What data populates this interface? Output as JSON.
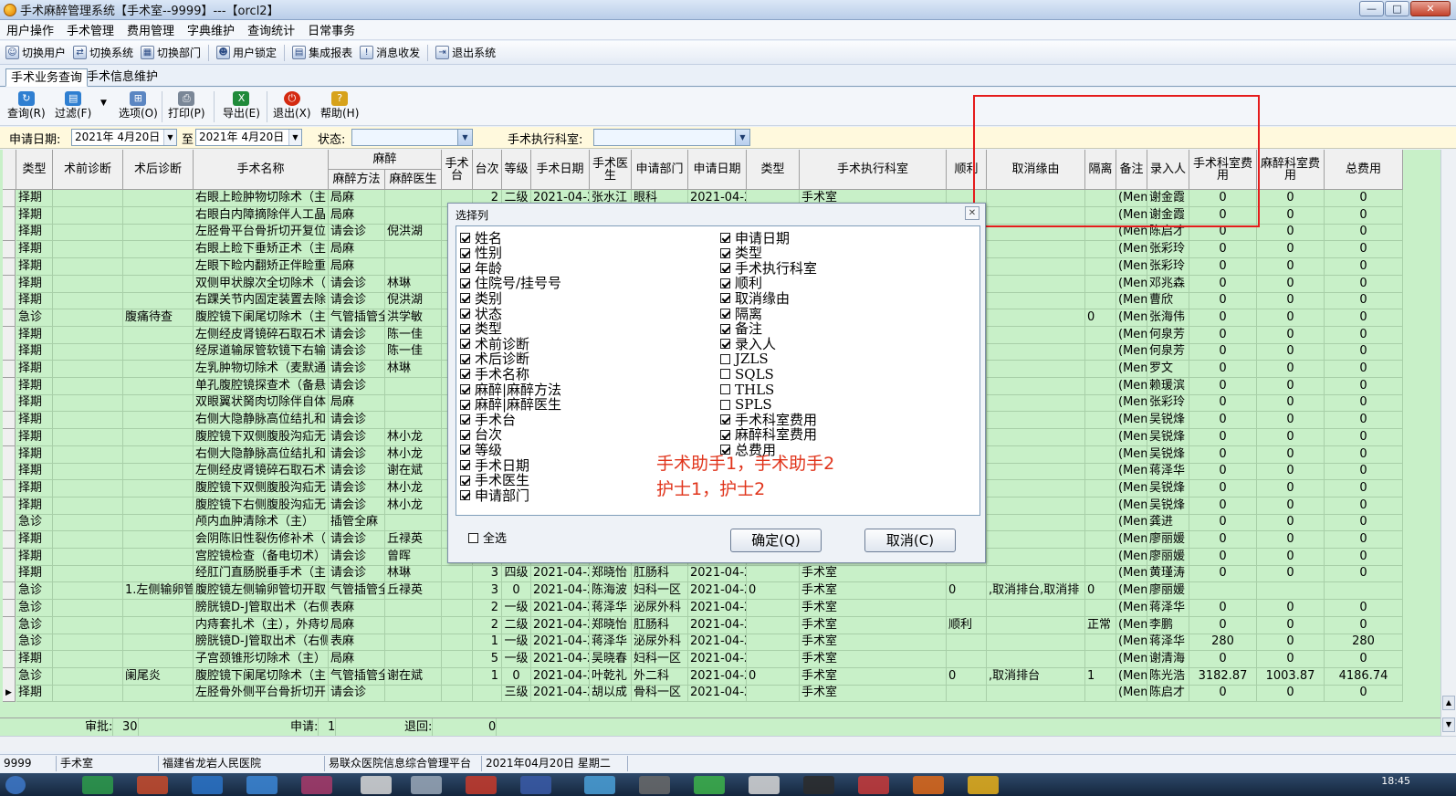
{
  "window": {
    "title": "手术麻醉管理系统【手术室--9999】---【orcl2】",
    "minimize": "—",
    "restore": "□",
    "close": "✕"
  },
  "menu": [
    "用户操作",
    "手术管理",
    "费用管理",
    "字典维护",
    "查询统计",
    "日常事务"
  ],
  "toolbar": [
    {
      "label": "切换用户",
      "icon": "users-icon"
    },
    {
      "label": "切换系统",
      "icon": "switch-system-icon"
    },
    {
      "label": "切换部门",
      "icon": "switch-department-icon"
    },
    {
      "label": "用户锁定",
      "icon": "lock-icon"
    },
    {
      "label": "集成报表",
      "icon": "report-icon"
    },
    {
      "label": "消息收发",
      "icon": "message-icon"
    },
    {
      "label": "退出系统",
      "icon": "exit-icon"
    }
  ],
  "tabs": [
    "手术业务查询",
    "手术信息维护"
  ],
  "actions": [
    {
      "label": "查询(R)",
      "icon": "query-icon",
      "color": "#2f7fd1"
    },
    {
      "label": "过滤(F)",
      "icon": "filter-icon",
      "color": "#2f7fd1"
    },
    {
      "label": "选项(O)",
      "icon": "options-icon",
      "color": "#5b86c2"
    },
    {
      "label": "打印(P)",
      "icon": "print-icon",
      "color": "#7a8797"
    },
    {
      "label": "导出(E)",
      "icon": "excel-icon",
      "color": "#1f8a3a"
    },
    {
      "label": "退出(X)",
      "icon": "power-icon",
      "color": "#d42a10"
    },
    {
      "label": "帮助(H)",
      "icon": "help-icon",
      "color": "#d7a21a"
    }
  ],
  "filter": {
    "date_label": "申请日期:",
    "date_from": "2021年 4月20日",
    "to_label": "至",
    "date_to": "2021年 4月20日",
    "status_label": "状态:",
    "status_value": "",
    "dept_label": "手术执行科室:",
    "dept_value": ""
  },
  "grid": {
    "group_header": "麻醉",
    "headers": [
      "类型",
      "术前诊断",
      "术后诊断",
      "手术名称",
      "麻醉方法",
      "麻醉医生",
      "手术台",
      "台次",
      "等级",
      "手术日期",
      "手术医生",
      "申请部门",
      "申请日期",
      "类型",
      "手术执行科室",
      "顺利",
      "取消缘由",
      "隔离",
      "备注",
      "录入人",
      "手术科室费用",
      "麻醉科室费用",
      "总费用"
    ],
    "rows": [
      [
        "择期",
        "",
        "",
        "右眼上睑肿物切除术（主",
        "局麻",
        "",
        "",
        "2",
        "二级",
        "2021-04-2",
        "张水江",
        "眼科",
        "2021-04-2",
        "",
        "手术室",
        "",
        "",
        "",
        "(Memo",
        "谢金霞",
        "0",
        "0",
        "0"
      ],
      [
        "择期",
        "",
        "",
        "右眼白内障摘除伴人工晶",
        "局麻",
        "",
        "",
        "",
        "",
        "",
        "",
        "",
        "",
        "",
        "",
        "",
        "",
        "",
        "(Memo",
        "谢金霞",
        "0",
        "0",
        "0"
      ],
      [
        "择期",
        "",
        "",
        "左胫骨平台骨折切开复位",
        "请会诊",
        "倪洪湖",
        "",
        "",
        "",
        "",
        "",
        "",
        "",
        "",
        "",
        "",
        "",
        "",
        "(Memo",
        "陈启才",
        "0",
        "0",
        "0"
      ],
      [
        "择期",
        "",
        "",
        "右眼上睑下垂矫正术（主",
        "局麻",
        "",
        "",
        "",
        "",
        "",
        "",
        "",
        "",
        "",
        "",
        "",
        "",
        "",
        "(Memo",
        "张彩玲",
        "0",
        "0",
        "0"
      ],
      [
        "择期",
        "",
        "",
        "左眼下睑内翻矫正伴睑重",
        "局麻",
        "",
        "",
        "",
        "",
        "",
        "",
        "",
        "",
        "",
        "",
        "",
        "",
        "",
        "(Memo",
        "张彩玲",
        "0",
        "0",
        "0"
      ],
      [
        "择期",
        "",
        "",
        "双侧甲状腺次全切除术（",
        "请会诊",
        "林琳",
        "",
        "",
        "",
        "",
        "",
        "",
        "",
        "",
        "",
        "",
        "",
        "",
        "(Memo",
        "邓兆森",
        "0",
        "0",
        "0"
      ],
      [
        "择期",
        "",
        "",
        "右踝关节内固定装置去除",
        "请会诊",
        "倪洪湖",
        "",
        "",
        "",
        "",
        "",
        "",
        "",
        "",
        "",
        "",
        "",
        "",
        "(Memo",
        "曹欣",
        "0",
        "0",
        "0"
      ],
      [
        "急诊",
        "",
        "腹痛待查",
        "腹腔镜下阑尾切除术（主",
        "气管插管全",
        "洪学敏",
        "",
        "",
        "",
        "",
        "",
        "",
        "",
        "",
        "",
        "",
        "",
        "0",
        "(Memo",
        "张海伟",
        "0",
        "0",
        "0"
      ],
      [
        "择期",
        "",
        "",
        "左侧经皮肾镜碎石取石术",
        "请会诊",
        "陈一佳",
        "",
        "",
        "",
        "",
        "",
        "",
        "",
        "",
        "",
        "",
        "",
        "",
        "(Memo",
        "何泉芳",
        "0",
        "0",
        "0"
      ],
      [
        "择期",
        "",
        "",
        "经尿道输尿管软镜下右输",
        "请会诊",
        "陈一佳",
        "",
        "",
        "",
        "",
        "",
        "",
        "",
        "",
        "",
        "",
        "",
        "",
        "(Memo",
        "何泉芳",
        "0",
        "0",
        "0"
      ],
      [
        "择期",
        "",
        "",
        "左乳肿物切除术（麦默通",
        "请会诊",
        "林琳",
        "",
        "",
        "",
        "",
        "",
        "",
        "",
        "",
        "",
        "",
        "",
        "",
        "(Memo",
        "罗文",
        "0",
        "0",
        "0"
      ],
      [
        "择期",
        "",
        "",
        "单孔腹腔镜探查术（备悬",
        "请会诊",
        "",
        "",
        "",
        "",
        "",
        "",
        "",
        "",
        "",
        "",
        "",
        "",
        "",
        "(Memo",
        "赖瑗滨",
        "0",
        "0",
        "0"
      ],
      [
        "择期",
        "",
        "",
        "双眼翼状胬肉切除伴自体",
        "局麻",
        "",
        "",
        "",
        "",
        "",
        "",
        "",
        "",
        "",
        "",
        "",
        "",
        "",
        "(Memo",
        "张彩玲",
        "0",
        "0",
        "0"
      ],
      [
        "择期",
        "",
        "",
        "右侧大隐静脉高位结扎和",
        "请会诊",
        "",
        "",
        "",
        "",
        "",
        "",
        "",
        "",
        "",
        "",
        "",
        "",
        "",
        "(Memo",
        "吴锐烽",
        "0",
        "0",
        "0"
      ],
      [
        "择期",
        "",
        "",
        "腹腔镜下双侧腹股沟疝无",
        "请会诊",
        "林小龙",
        "",
        "",
        "",
        "",
        "",
        "",
        "",
        "",
        "",
        "",
        "",
        "",
        "(Memo",
        "吴锐烽",
        "0",
        "0",
        "0"
      ],
      [
        "择期",
        "",
        "",
        "右侧大隐静脉高位结扎和",
        "请会诊",
        "林小龙",
        "",
        "",
        "",
        "",
        "",
        "",
        "",
        "",
        "",
        "",
        "",
        "",
        "(Memo",
        "吴锐烽",
        "0",
        "0",
        "0"
      ],
      [
        "择期",
        "",
        "",
        "左侧经皮肾镜碎石取石术",
        "请会诊",
        "谢在斌",
        "",
        "",
        "",
        "",
        "",
        "",
        "",
        "",
        "",
        "",
        "",
        "",
        "(Memo",
        "蒋泽华",
        "0",
        "0",
        "0"
      ],
      [
        "择期",
        "",
        "",
        "腹腔镜下双侧腹股沟疝无",
        "请会诊",
        "林小龙",
        "",
        "",
        "",
        "",
        "",
        "",
        "",
        "",
        "",
        "",
        "",
        "",
        "(Memo",
        "吴锐烽",
        "0",
        "0",
        "0"
      ],
      [
        "择期",
        "",
        "",
        "腹腔镜下右侧腹股沟疝无",
        "请会诊",
        "林小龙",
        "",
        "",
        "",
        "",
        "",
        "",
        "",
        "",
        "",
        "",
        "",
        "",
        "(Memo",
        "吴锐烽",
        "0",
        "0",
        "0"
      ],
      [
        "急诊",
        "",
        "",
        "颅内血肿清除术（主）",
        "插管全麻",
        "",
        "",
        "",
        "",
        "",
        "",
        "",
        "",
        "",
        "",
        "",
        "",
        "",
        "(Memo",
        "龚进",
        "0",
        "0",
        "0"
      ],
      [
        "择期",
        "",
        "",
        "会阴陈旧性裂伤修补术（",
        "请会诊",
        "丘禄英",
        "",
        "",
        "",
        "",
        "",
        "",
        "",
        "",
        "",
        "",
        "",
        "",
        "(Memo",
        "廖丽媛",
        "0",
        "0",
        "0"
      ],
      [
        "择期",
        "",
        "",
        "宫腔镜检查（备电切术）",
        "请会诊",
        "曾晖",
        "",
        "",
        "",
        "",
        "",
        "",
        "",
        "",
        "",
        "",
        "",
        "",
        "(Memo",
        "廖丽媛",
        "0",
        "0",
        "0"
      ],
      [
        "择期",
        "",
        "",
        "经肛门直肠脱垂手术（主",
        "请会诊",
        "林琳",
        "",
        "3",
        "四级",
        "2021-04-2",
        "郑晓怡",
        "肛肠科",
        "2021-04-2",
        "",
        "手术室",
        "",
        "",
        "",
        "(Memo",
        "黄瑾涛",
        "0",
        "0",
        "0"
      ],
      [
        "急诊",
        "",
        "1.左侧输卵管",
        "腹腔镜左侧输卵管切开取",
        "气管插管全",
        "丘禄英",
        "",
        "3",
        "0",
        "2021-04-2",
        "陈海波",
        "妇科一区",
        "2021-04-2",
        "0",
        "手术室",
        "0",
        ",取消排台,取消排",
        "0",
        "(Memo",
        "廖丽媛",
        "",
        "",
        ""
      ],
      [
        "急诊",
        "",
        "",
        "膀胱镜D-J管取出术（右侧",
        "表麻",
        "",
        "",
        "2",
        "一级",
        "2021-04-2",
        "蒋泽华",
        "泌尿外科",
        "2021-04-2",
        "",
        "手术室",
        "",
        "",
        "",
        "(Memo",
        "蒋泽华",
        "0",
        "0",
        "0"
      ],
      [
        "急诊",
        "",
        "",
        "内痔套扎术（主），外痔切",
        "局麻",
        "",
        "",
        "2",
        "二级",
        "2021-04-2",
        "郑晓怡",
        "肛肠科",
        "2021-04-2",
        "",
        "手术室",
        "顺利",
        "",
        "正常",
        "(Memo",
        "李鹏",
        "0",
        "0",
        "0"
      ],
      [
        "急诊",
        "",
        "",
        "膀胱镜D-J管取出术（右侧",
        "表麻",
        "",
        "",
        "1",
        "一级",
        "2021-04-2",
        "蒋泽华",
        "泌尿外科",
        "2021-04-2",
        "",
        "手术室",
        "",
        "",
        "",
        "(Memo",
        "蒋泽华",
        "280",
        "0",
        "280"
      ],
      [
        "择期",
        "",
        "",
        "子宫颈锥形切除术（主）",
        "局麻",
        "",
        "",
        "5",
        "一级",
        "2021-04-2",
        "吴晓春",
        "妇科一区",
        "2021-04-2",
        "",
        "手术室",
        "",
        "",
        "",
        "(Memo",
        "谢清海",
        "0",
        "0",
        "0"
      ],
      [
        "急诊",
        "",
        "阑尾炎",
        "腹腔镜下阑尾切除术（主",
        "气管插管全",
        "谢在斌",
        "",
        "1",
        "0",
        "2021-04-2",
        "叶乾礼",
        "外二科",
        "2021-04-2",
        "0",
        "手术室",
        "0",
        ",取消排台",
        "1",
        "(Memo",
        "陈光浩",
        "3182.87",
        "1003.87",
        "4186.74"
      ],
      [
        "择期",
        "",
        "",
        "左胫骨外侧平台骨折切开",
        "请会诊",
        "",
        "",
        "",
        "三级",
        "2021-04-2",
        "胡以成",
        "骨科一区",
        "2021-04-2",
        "",
        "手术室",
        "",
        "",
        "",
        "(Memo",
        "陈启才",
        "0",
        "0",
        "0"
      ]
    ]
  },
  "footer": {
    "approved_label": "审批:",
    "approved": "30",
    "apply_label": "申请:",
    "apply": "1",
    "return_label": "退回:",
    "return": "0"
  },
  "dialog": {
    "title": "选择列",
    "col1": [
      {
        "label": "姓名",
        "checked": true
      },
      {
        "label": "性别",
        "checked": true
      },
      {
        "label": "年龄",
        "checked": true
      },
      {
        "label": "住院号/挂号号",
        "checked": true
      },
      {
        "label": "类别",
        "checked": true
      },
      {
        "label": "状态",
        "checked": true
      },
      {
        "label": "类型",
        "checked": true
      },
      {
        "label": "术前诊断",
        "checked": true
      },
      {
        "label": "术后诊断",
        "checked": true
      },
      {
        "label": "手术名称",
        "checked": true
      },
      {
        "label": "麻醉|麻醉方法",
        "checked": true
      },
      {
        "label": "麻醉|麻醉医生",
        "checked": true
      },
      {
        "label": "手术台",
        "checked": true
      },
      {
        "label": "台次",
        "checked": true
      },
      {
        "label": "等级",
        "checked": true
      },
      {
        "label": "手术日期",
        "checked": true
      },
      {
        "label": "手术医生",
        "checked": true
      },
      {
        "label": "申请部门",
        "checked": true
      }
    ],
    "col2": [
      {
        "label": "申请日期",
        "checked": true
      },
      {
        "label": "类型",
        "checked": true
      },
      {
        "label": "手术执行科室",
        "checked": true
      },
      {
        "label": "顺利",
        "checked": true
      },
      {
        "label": "取消缘由",
        "checked": true
      },
      {
        "label": "隔离",
        "checked": true
      },
      {
        "label": "备注",
        "checked": true
      },
      {
        "label": "录入人",
        "checked": true
      },
      {
        "label": "JZLS",
        "checked": false
      },
      {
        "label": "SQLS",
        "checked": false
      },
      {
        "label": "THLS",
        "checked": false
      },
      {
        "label": "SPLS",
        "checked": false
      },
      {
        "label": "手术科室费用",
        "checked": true
      },
      {
        "label": "麻醉科室费用",
        "checked": true
      },
      {
        "label": "总费用",
        "checked": true
      }
    ],
    "annotation_line1": "手术助手1，手术助手2",
    "annotation_line2": "护士1，护士2",
    "select_all": "全选",
    "ok": "确定(Q)",
    "cancel": "取消(C)"
  },
  "status": [
    "9999",
    "手术室",
    "福建省龙岩人民医院",
    "易联众医院信息综合管理平台",
    "2021年04月20日 星期二"
  ],
  "clock": "18:45"
}
